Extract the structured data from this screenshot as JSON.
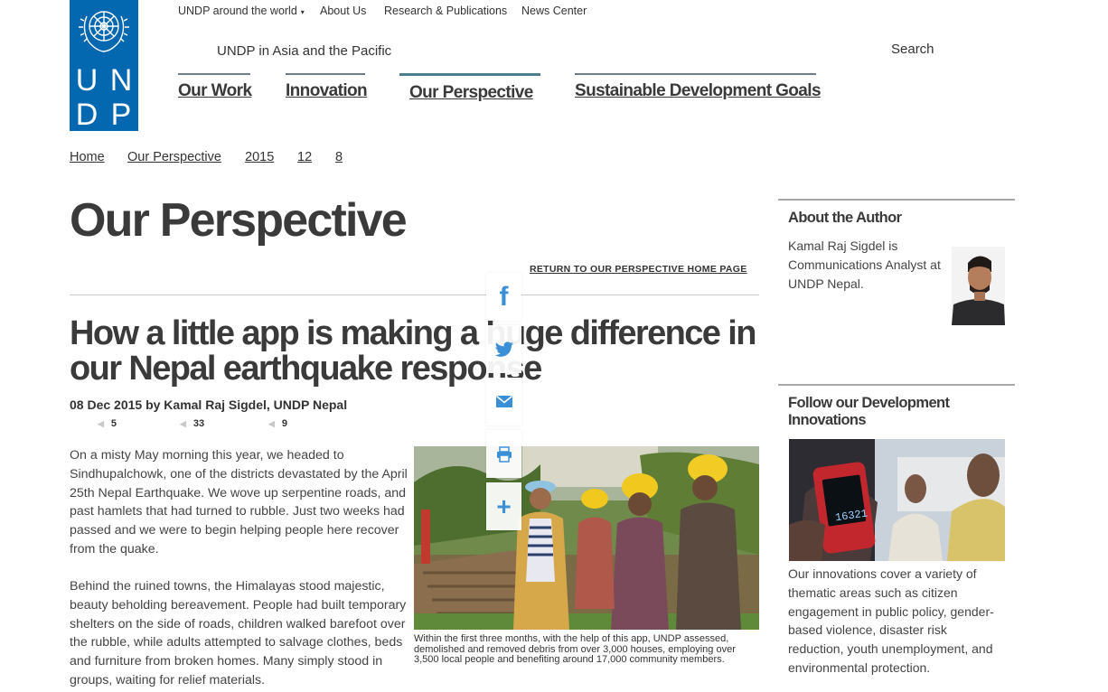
{
  "logo": {
    "letters": [
      "U",
      "N",
      "D",
      "P"
    ]
  },
  "top_nav": [
    {
      "label": "UNDP around the world",
      "has_dropdown": true,
      "dropdown_glyph": "▾"
    },
    {
      "label": "About Us"
    },
    {
      "label": "Research & Publications"
    },
    {
      "label": "News Center"
    }
  ],
  "region": "UNDP in Asia and the Pacific",
  "search_label": "Search",
  "main_nav": [
    {
      "label": "Our Work"
    },
    {
      "label": "Innovation"
    },
    {
      "label": "Our Perspective",
      "active": true
    },
    {
      "label": "Sustainable Development Goals"
    }
  ],
  "breadcrumbs": [
    "Home",
    "Our Perspective",
    "2015",
    "12",
    "8"
  ],
  "page_title": "Our Perspective",
  "return_link": "RETURN TO OUR PERSPECTIVE HOME PAGE",
  "article": {
    "title": "How a little app is making a huge difference in our Nepal earthquake response",
    "byline": "08 Dec 2015 by Kamal Raj Sigdel, UNDP Nepal",
    "share_counts": [
      "5",
      "33",
      "9"
    ],
    "paragraphs": [
      "On a misty May morning this year, we headed to Sindhupalchowk, one of the districts devastated by the April 25th Nepal Earthquake. We wove up serpentine roads, and past hamlets that had turned to rubble. Just two weeks had passed and we were to begin helping people here recover from the quake.",
      "Behind the ruined towns, the Himalayas stood majestic, beauty beholding  bereavement. People had built temporary shelters on the side of roads,  children walked barefoot over the rubble, while adults attempted to salvage clothes, beds and furniture from broken homes. Many simply stood in groups, waiting for relief materials."
    ],
    "photo_caption": "Within the first three months, with the help of this app, UNDP assessed, demolished and removed debris from over 3,000 houses, employing over 3,500 local people and benefiting around 17,000 community members."
  },
  "social_buttons": [
    {
      "icon": "facebook-icon",
      "glyph": "f",
      "color": "#3b8fd6"
    },
    {
      "icon": "twitter-icon",
      "color": "#3b8fd6"
    },
    {
      "icon": "email-icon",
      "color": "#3b8fd6"
    },
    {
      "icon": "print-icon",
      "color": "#3b8fd6"
    },
    {
      "icon": "plus-icon",
      "glyph": "+",
      "color": "#3b8fd6"
    }
  ],
  "sidebar": {
    "author_heading": "About the Author",
    "author_bio": "Kamal Raj Sigdel is Communications Analyst at UNDP Nepal.",
    "innovations_heading": "Follow our Development Innovations",
    "innovations_device_reading": "16321",
    "innovations_text": "Our innovations cover a variety of thematic areas such as citizen engagement in public policy, gender-based violence, disaster risk reduction, youth unemployment, and environmental protection."
  },
  "colors": {
    "undp_blue": "#0468b1",
    "text": "#3a3a3a",
    "nav_rule": "#6b7f8a",
    "social_blue": "#3b8fd6"
  }
}
